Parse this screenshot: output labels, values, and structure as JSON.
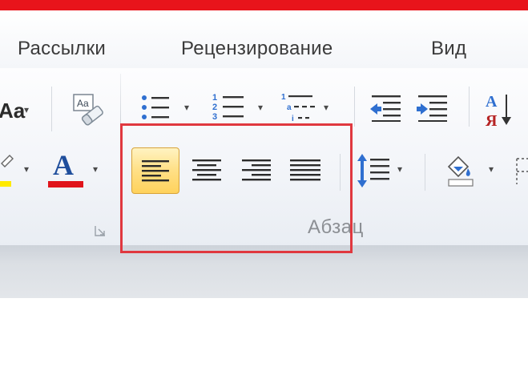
{
  "tabs": {
    "mailings": "Рассылки",
    "review": "Рецензирование",
    "view": "Вид"
  },
  "font_group": {
    "font_case_fragment": "Aa",
    "font_color_letter": "A",
    "font_color_hex": "#e0141b",
    "highlight_color_hex": "#ffea00"
  },
  "paragraph_group": {
    "label": "Абзац",
    "sort_letters": [
      "А",
      "Я"
    ],
    "align_active": "align-left"
  },
  "icons": [
    "clear-formatting-icon",
    "bullets-icon",
    "numbering-icon",
    "multilevel-list-icon",
    "decrease-indent-icon",
    "increase-indent-icon",
    "sort-icon",
    "text-highlight-icon",
    "font-color-icon",
    "align-left-icon",
    "align-center-icon",
    "align-right-icon",
    "justify-icon",
    "line-spacing-icon",
    "shading-icon",
    "borders-icon",
    "dialog-launcher-icon"
  ],
  "colors": {
    "title_bar": "#e8141b",
    "active_button": "#ffe18a",
    "highlight_frame": "#e0383f"
  }
}
